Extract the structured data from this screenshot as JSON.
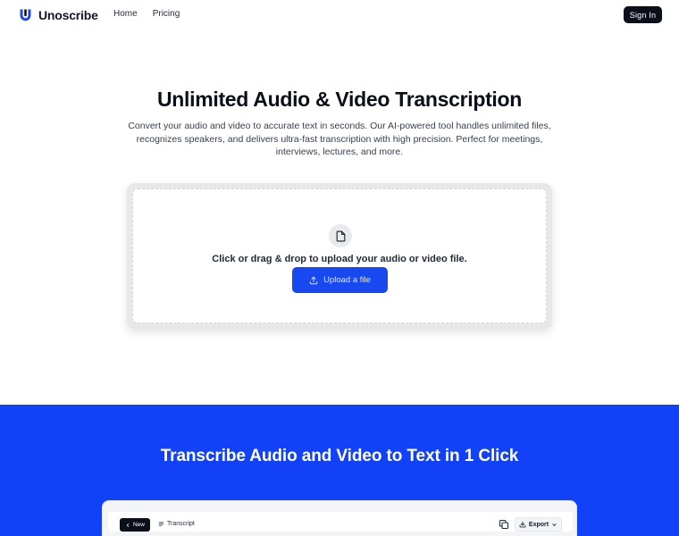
{
  "nav": {
    "brand": "Unoscribe",
    "links": [
      {
        "label": "Home"
      },
      {
        "label": "Pricing"
      }
    ],
    "signin_label": "Sign In"
  },
  "hero": {
    "title": "Unlimited Audio & Video Transcription",
    "description": "Convert your audio and video to accurate text in seconds. Our AI-powered tool handles unlimited files, recognizes speakers, and delivers ultra-fast transcription with high precision. Perfect for meetings, interviews, lectures, and more."
  },
  "upload": {
    "prompt": "Click or drag & drop to upload your audio or video file.",
    "button_label": "Upload a file"
  },
  "section": {
    "title": "Transcribe Audio and Video to Text in 1 Click"
  },
  "preview": {
    "new_label": "New",
    "tab_label": "Transcript",
    "export_label": "Export"
  },
  "colors": {
    "accent": "#1848f0",
    "section_bg": "#1242f7",
    "dark": "#0b0f19"
  },
  "icons": {
    "logo": "unoscribe-logo-icon",
    "file": "file-icon",
    "upload": "upload-icon",
    "chevron_left": "chevron-left-icon",
    "list": "list-icon",
    "copy": "copy-icon",
    "download": "download-icon",
    "chevron_down": "chevron-down-icon"
  }
}
